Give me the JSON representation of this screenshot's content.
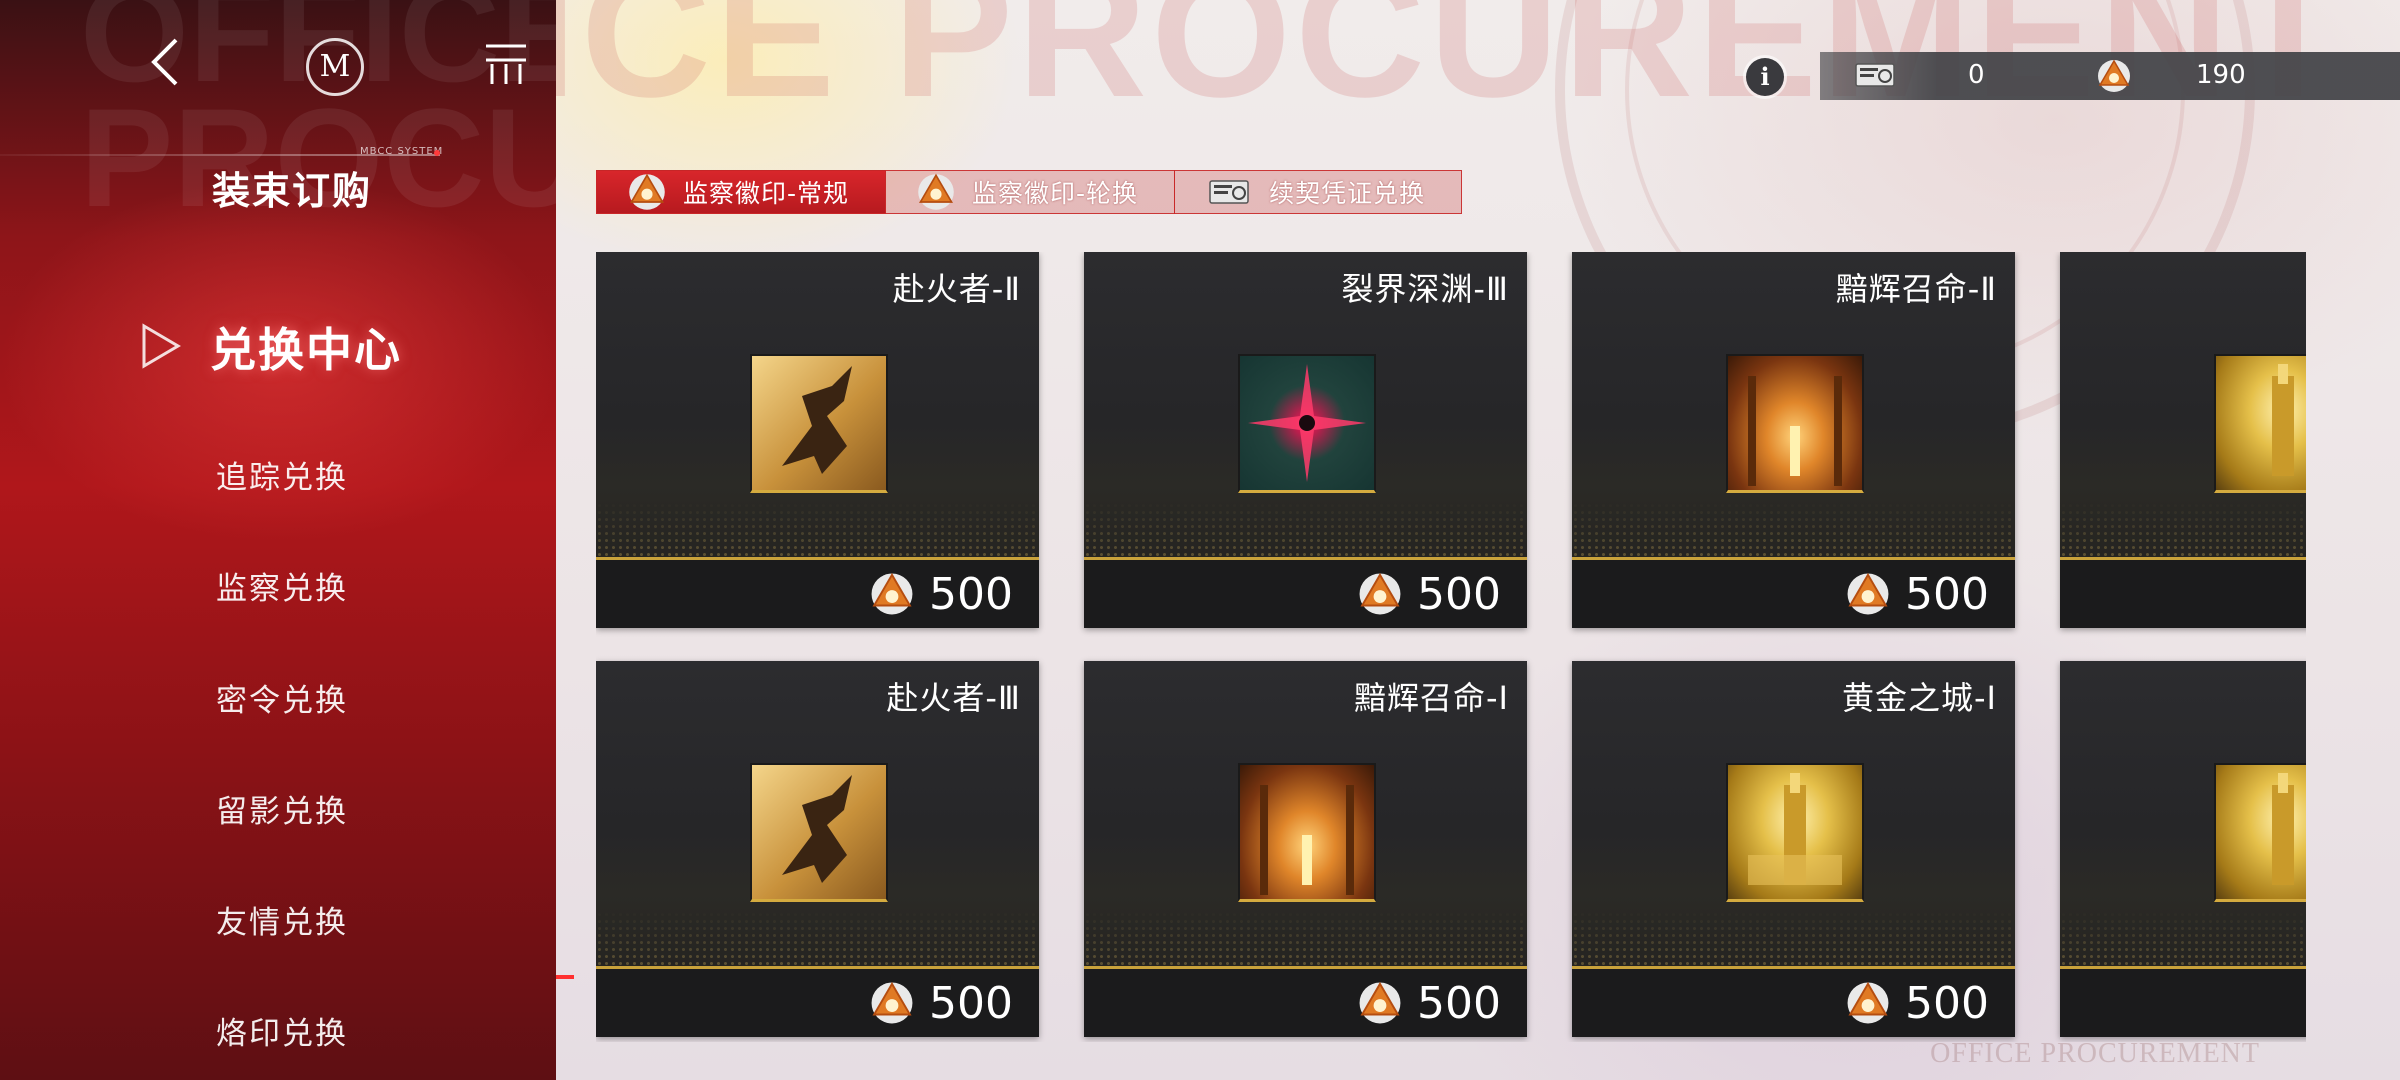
{
  "sidebar": {
    "bg_title": "OFFICE PROCUREMENT",
    "system_tag": "MBCC SYSTEM",
    "logo_letter": "M",
    "section_title": "装束订购",
    "active_item": "兑换中心",
    "items": [
      {
        "label": "追踪兑换"
      },
      {
        "label": "监察兑换"
      },
      {
        "label": "密令兑换"
      },
      {
        "label": "留影兑换"
      },
      {
        "label": "友情兑换"
      },
      {
        "label": "烙印兑换"
      }
    ]
  },
  "topbar": {
    "info_label": "i",
    "currencies": [
      {
        "icon": "contract-voucher-icon",
        "value": "0"
      },
      {
        "icon": "inspection-badge-icon",
        "value": "190"
      }
    ]
  },
  "tabs": [
    {
      "label": "监察徽印-常规",
      "icon": "inspection-badge-icon",
      "active": true
    },
    {
      "label": "监察徽印-轮换",
      "icon": "inspection-badge-icon",
      "active": false
    },
    {
      "label": "续契凭证兑换",
      "icon": "contract-voucher-icon",
      "active": false
    }
  ],
  "cards": [
    {
      "name": "赴火者-Ⅱ",
      "price": "500",
      "art": "runner"
    },
    {
      "name": "裂界深渊-Ⅲ",
      "price": "500",
      "art": "abyss"
    },
    {
      "name": "黯辉召命-Ⅱ",
      "price": "500",
      "art": "hall"
    },
    {
      "name": "",
      "price": "",
      "art": "gold"
    },
    {
      "name": "赴火者-Ⅲ",
      "price": "500",
      "art": "runner"
    },
    {
      "name": "黯辉召命-Ⅰ",
      "price": "500",
      "art": "hall"
    },
    {
      "name": "黄金之城-Ⅰ",
      "price": "500",
      "art": "gold"
    },
    {
      "name": "",
      "price": "",
      "art": "gold"
    }
  ],
  "footer_watermark": "OFFICE PROCUREMENT",
  "colors": {
    "accent_red": "#c8181d",
    "gold": "#c9a23b",
    "card_dark": "#262628"
  }
}
